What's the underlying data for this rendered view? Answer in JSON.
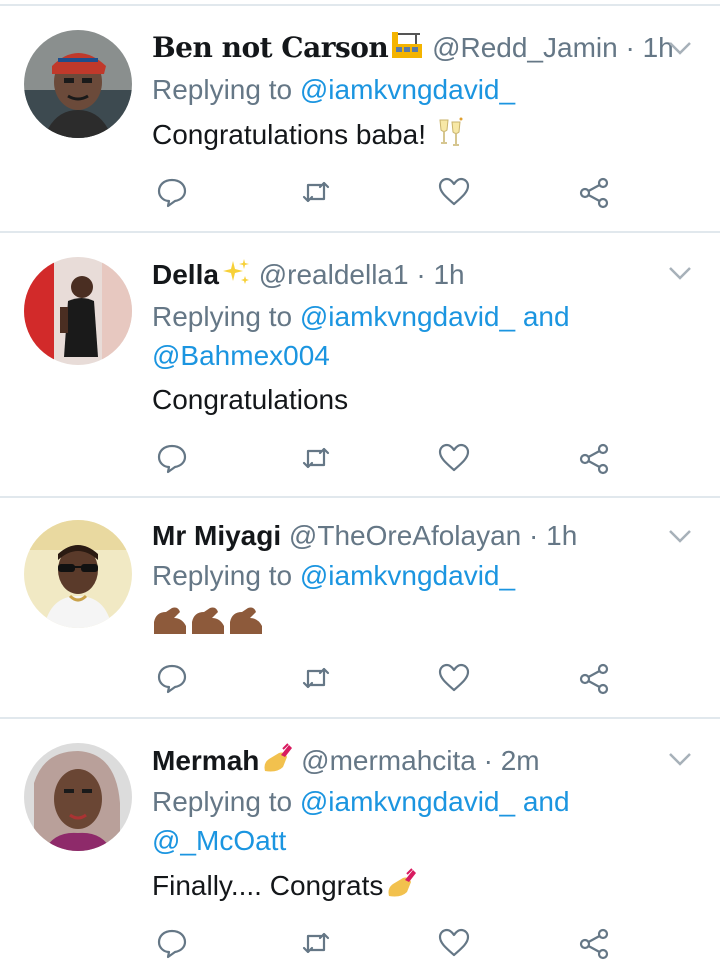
{
  "colors": {
    "link": "#1b95e0",
    "muted": "#657786",
    "text": "#14171a",
    "divider": "#e1e8ed"
  },
  "common": {
    "replying_prefix": "Replying to",
    "and": "and",
    "dot": "·"
  },
  "tweets": [
    {
      "name": "Ben not Carson",
      "name_emoji": "construction-site-icon",
      "handle": "@Redd_Jamin",
      "time": "1h",
      "reply_to": [
        "@iamkvngdavid_"
      ],
      "text": "Congratulations baba!",
      "text_emoji": "champagne-glasses-icon"
    },
    {
      "name": "Della",
      "name_emoji": "sparkles-icon",
      "handle": "@realdella1",
      "time": "1h",
      "reply_to": [
        "@iamkvngdavid_",
        "@Bahmex004"
      ],
      "text": "Congratulations",
      "text_emoji": ""
    },
    {
      "name": "Mr Miyagi",
      "name_emoji": "",
      "handle": "@TheOreAfolayan",
      "time": "1h",
      "reply_to": [
        "@iamkvngdavid_"
      ],
      "text": "",
      "text_emoji": "flexed-biceps-icon x3"
    },
    {
      "name": "Mermah",
      "name_emoji": "nail-polish-icon",
      "handle": "@mermahcita",
      "time": "2m",
      "reply_to": [
        "@iamkvngdavid_",
        "@_McOatt"
      ],
      "text": "Finally.... Congrats",
      "text_emoji": "nail-polish-icon"
    }
  ],
  "actions": [
    "reply-icon",
    "retweet-icon",
    "like-icon",
    "share-icon"
  ]
}
